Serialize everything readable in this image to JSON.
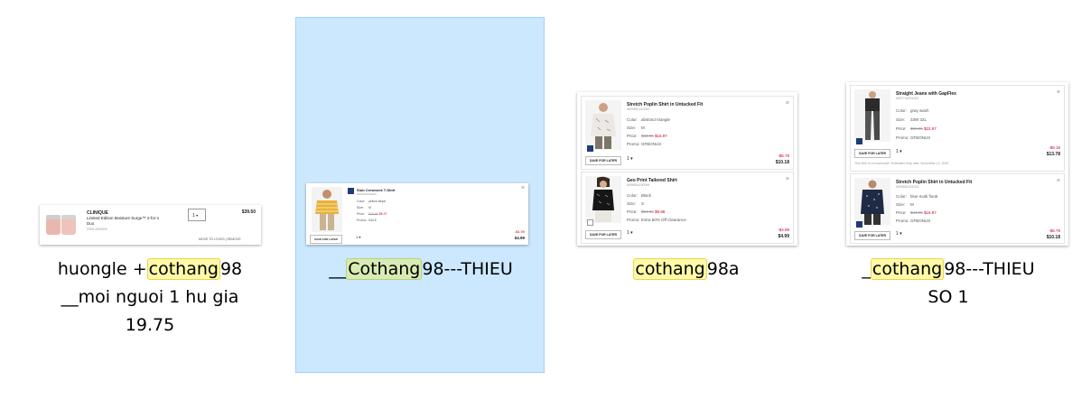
{
  "files": [
    {
      "caption_pre": "huongle +",
      "caption_hl": "cothang",
      "caption_post": "98",
      "caption_line2": "__moi nguoi 1 hu gia",
      "caption_line3": "19.75",
      "item": {
        "brand": "CLINIQUE",
        "name_line1": "Limited Edition Moisture Surge™ 2-for-1",
        "name_line2": "Duo",
        "sku": "ITEM 2599390",
        "qty": "1",
        "price": "$39.50",
        "move_to_loves": "MOVE TO LOVES",
        "remove": "REMOVE"
      }
    },
    {
      "caption_pre": "__",
      "caption_hl": "Cothang",
      "caption_post": "98---THIEU",
      "item": {
        "title": "Slub Crewneck T-Shirt",
        "sku": "#000000000000",
        "color_label": "Color:",
        "color": "yellow stripe",
        "size_label": "Size:",
        "size": "M",
        "price_label": "Price:",
        "price_old": "$16.95",
        "price_new": "$6.97",
        "promo_label": "Promo:",
        "promo": "SALE",
        "save_for_later": "SAVE FOR LATER",
        "qty": "1",
        "discount": "-$4.99",
        "total": "$4.99"
      }
    },
    {
      "caption_hl": "cothang",
      "caption_post": "98a",
      "items": [
        {
          "title": "Stretch Poplin Shirt in Untucked Fit",
          "sku": "#599851410000",
          "color_label": "Color:",
          "color": "abstract triangle",
          "size_label": "Size:",
          "size": "M",
          "price_label": "Price:",
          "price_old": "$44.95",
          "price_new": "$16.97",
          "promo_label": "Promo:",
          "promo": "GFBONUS",
          "save_for_later": "SAVE FOR LATER",
          "qty": "1",
          "discount": "-$6.79",
          "total": "$10.18"
        },
        {
          "title": "Geo Print Tailored Shirt",
          "sku": "#599804150096",
          "color_label": "Color:",
          "color": "Black",
          "size_label": "Size:",
          "size": "S",
          "price_label": "Price:",
          "price_old": "$54.99",
          "price_new": "$9.98",
          "promo_label": "Promo:",
          "promo": "Extra 50% Off Clearance",
          "save_for_later": "SAVE FOR LATER",
          "qty": "1",
          "discount": "-$4.99",
          "total": "$4.99"
        }
      ]
    },
    {
      "caption_pre": "_",
      "caption_hl": "cothang",
      "caption_post": "98---THIEU",
      "caption_line2": "SO 1",
      "items": [
        {
          "title": "Straight Jeans with GapFlex",
          "sku": "#597744001002",
          "color_label": "Color:",
          "color": "gray wash",
          "size_label": "Size:",
          "size": "33W 32L",
          "price_label": "Price:",
          "price_old": "$59.95",
          "price_new": "$22.97",
          "promo_label": "Promo:",
          "promo": "GFBONUS",
          "save_for_later": "SAVE FOR LATER",
          "qty": "1",
          "discount": "-$9.19",
          "total": "$13.78",
          "note": "This item is on backorder. Estimated ship date: November 12, 2020"
        },
        {
          "title": "Stretch Poplin Shirt in Untucked Fit",
          "sku": "#599851021002",
          "color_label": "Color:",
          "color": "blue multi floral",
          "size_label": "Size:",
          "size": "M",
          "price_label": "Price:",
          "price_old": "$44.95",
          "price_new": "$16.97",
          "promo_label": "Promo:",
          "promo": "GFBONUS",
          "save_for_later": "SAVE FOR LATER",
          "qty": "1",
          "discount": "-$6.79",
          "total": "$10.18"
        }
      ]
    }
  ],
  "colors": {
    "selection_bg": "#cce8ff",
    "highlight": "#fff9a8",
    "brand_navy": "#1f3b73"
  },
  "icons": [
    "close-icon",
    "chevron-down-icon",
    "gap-logo-icon"
  ]
}
